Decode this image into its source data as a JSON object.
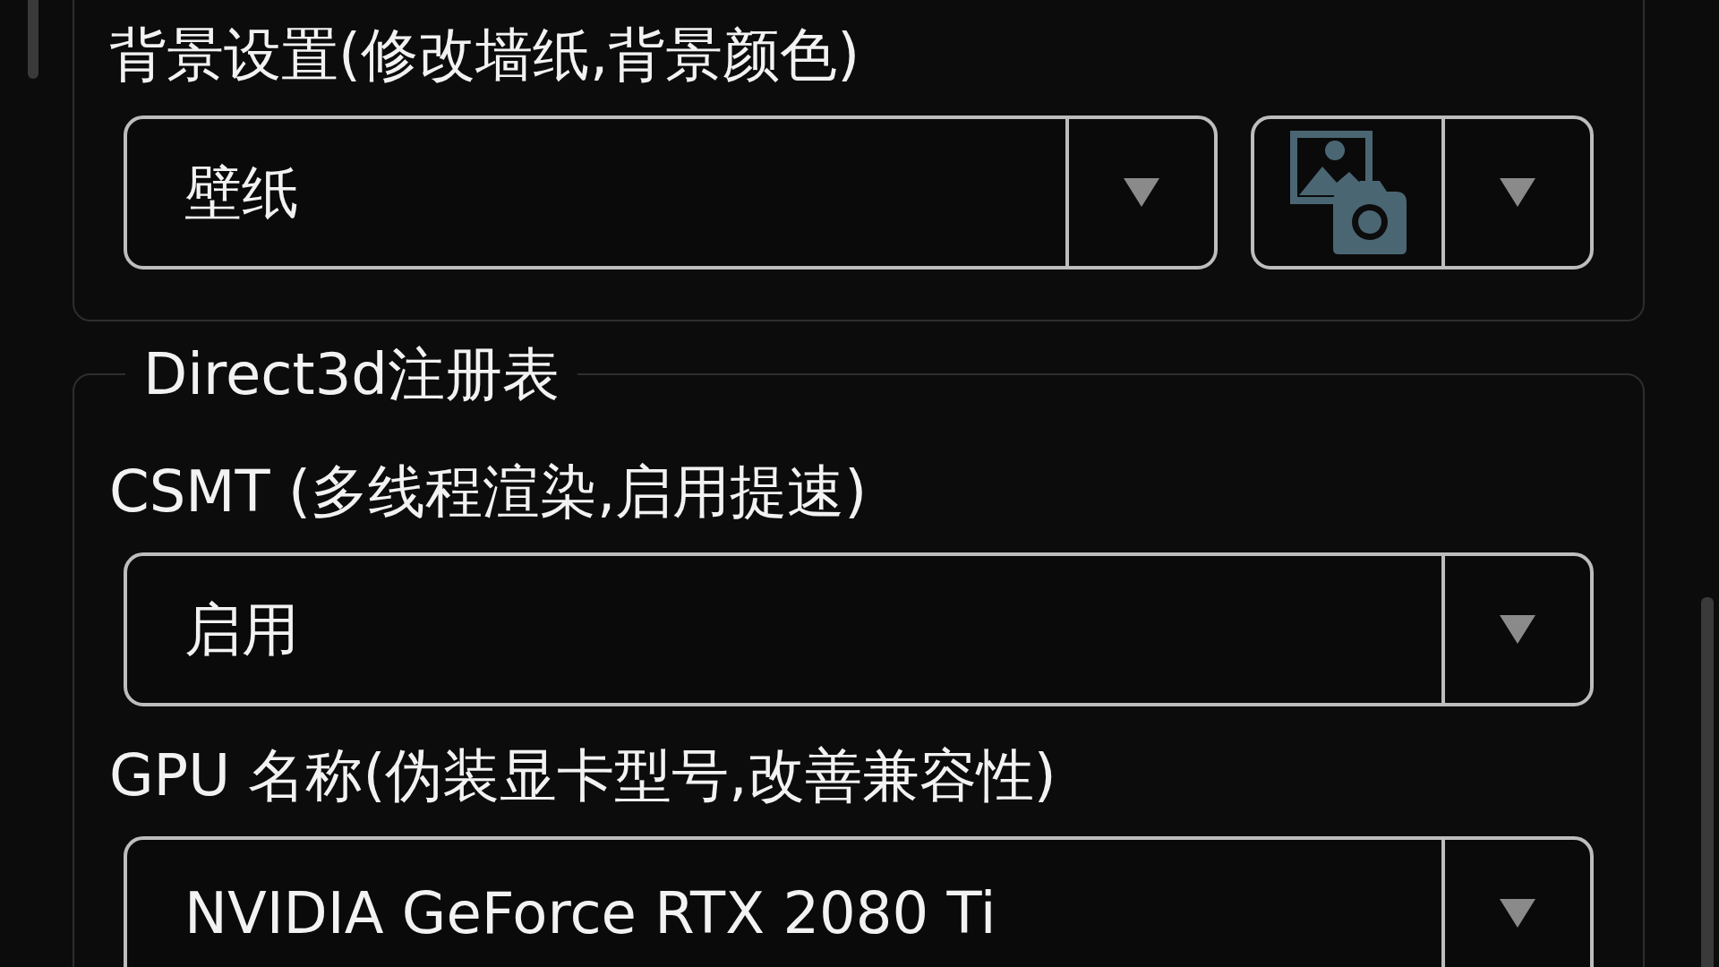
{
  "background_section": {
    "label": "背景设置(修改墙纸,背景颜色)",
    "mode_dropdown": {
      "value": "壁纸"
    }
  },
  "d3d_section": {
    "legend": "Direct3d注册表",
    "settings": [
      {
        "label": "CSMT (多线程渲染,启用提速)",
        "value": "启用"
      },
      {
        "label": "GPU 名称(伪装显卡型号,改善兼容性)",
        "value": "NVIDIA GeForce RTX 2080 Ti"
      }
    ]
  }
}
